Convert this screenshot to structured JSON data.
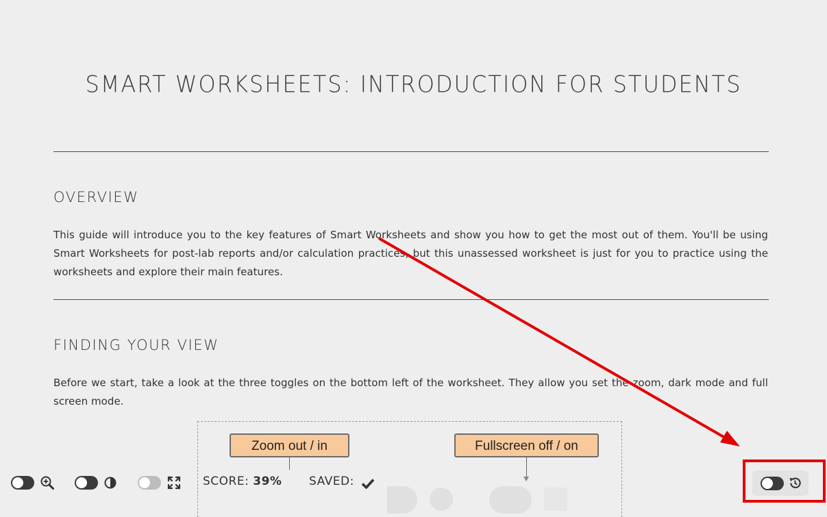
{
  "page": {
    "title": "SMART WORKSHEETS: INTRODUCTION FOR STUDENTS"
  },
  "sections": [
    {
      "heading": "OVERVIEW",
      "paragraph": "This guide will introduce you to the key features of Smart Worksheets and show you how to get the most out of them. You'll be using Smart Worksheets for post-lab reports and/or calculation practices, but this unassessed worksheet is just for you to practice using the worksheets and explore their main features."
    },
    {
      "heading": "FINDING YOUR VIEW",
      "paragraph": "Before we start, take a look at the three toggles on the bottom left of the worksheet. They allow you set the zoom, dark mode and full screen mode."
    }
  ],
  "figure": {
    "callouts": [
      "Zoom out / in",
      "Fullscreen off / on"
    ],
    "callout_color": "#f8c99a"
  },
  "toolbar": {
    "zoom_icon": "zoom-in-icon",
    "contrast_icon": "contrast-icon",
    "fullscreen_icon": "expand-icon",
    "score_label": "SCORE:",
    "score_value": "39%",
    "saved_label": "SAVED:",
    "saved_icon": "checkmark-icon",
    "history_icon": "history-icon"
  },
  "annotation": {
    "color": "#e30000"
  }
}
